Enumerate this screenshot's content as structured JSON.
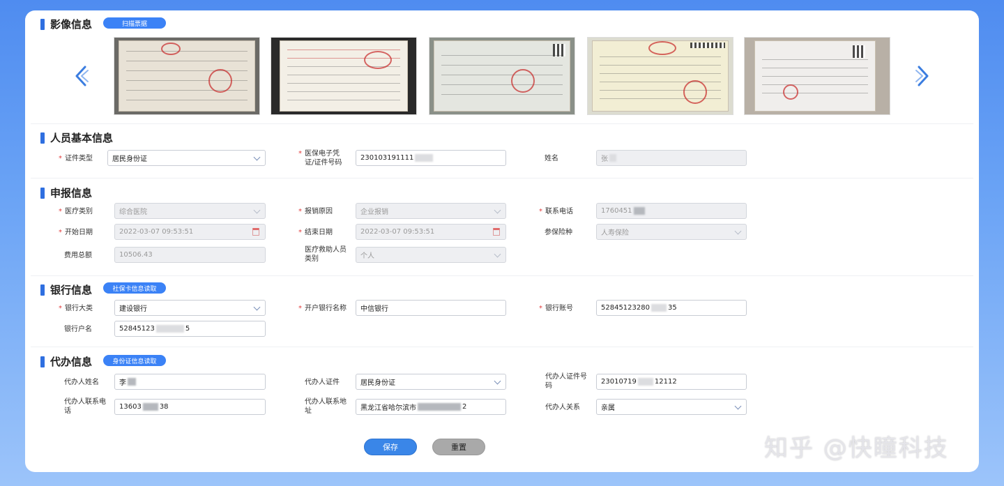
{
  "sections": {
    "image": {
      "title": "影像信息",
      "button": "扫描票据"
    },
    "basic": {
      "title": "人员基本信息"
    },
    "claim": {
      "title": "申报信息"
    },
    "bank": {
      "title": "银行信息",
      "button": "社保卡信息读取"
    },
    "agent": {
      "title": "代办信息",
      "button": "身份证信息读取"
    }
  },
  "basic": {
    "id_type_label": "证件类型",
    "id_type_value": "居民身份证",
    "id_no_label_1": "医保电子凭",
    "id_no_label_2": "证/证件号码",
    "id_no_value": "230103191111",
    "name_label": "姓名",
    "name_value": "张"
  },
  "claim": {
    "med_type_label": "医疗类别",
    "med_type_value": "综合医院",
    "reason_label": "报销原因",
    "reason_value": "企业报销",
    "phone_label": "联系电话",
    "phone_value": "1760451",
    "start_label": "开始日期",
    "start_value": "2022-03-07 09:53:51",
    "end_label": "结束日期",
    "end_value": "2022-03-07 09:53:51",
    "insurance_label": "参保险种",
    "insurance_value": "人寿保险",
    "total_label": "费用总额",
    "total_value": "10506.43",
    "aid_label_1": "医疗救助人员",
    "aid_label_2": "类别",
    "aid_value": "个人"
  },
  "bank": {
    "category_label": "银行大类",
    "category_value": "建设银行",
    "branch_label": "开户银行名称",
    "branch_value": "中信银行",
    "account_label": "银行账号",
    "account_value_a": "52845123280",
    "account_value_b": "35",
    "holder_label": "银行户名",
    "holder_value_a": "52845123",
    "holder_value_b": "5"
  },
  "agent": {
    "name_label": "代办人姓名",
    "name_value": "李",
    "cert_label": "代办人证件",
    "cert_value": "居民身份证",
    "cert_no_label_1": "代办人证件号",
    "cert_no_label_2": "码",
    "cert_no_value_a": "23010719",
    "cert_no_value_b": "12112",
    "phone_label_1": "代办人联系电",
    "phone_label_2": "话",
    "phone_value_a": "13603",
    "phone_value_b": "38",
    "address_label_1": "代办人联系地",
    "address_label_2": "址",
    "address_value_a": "黑龙江省哈尔滨市",
    "address_value_b": "2",
    "relation_label": "代办人关系",
    "relation_value": "亲属"
  },
  "actions": {
    "save": "保存",
    "reset": "重置"
  },
  "watermark": "知乎 @快瞳科技",
  "colors": {
    "accent": "#3b82f6",
    "required": "#e23b3b"
  }
}
